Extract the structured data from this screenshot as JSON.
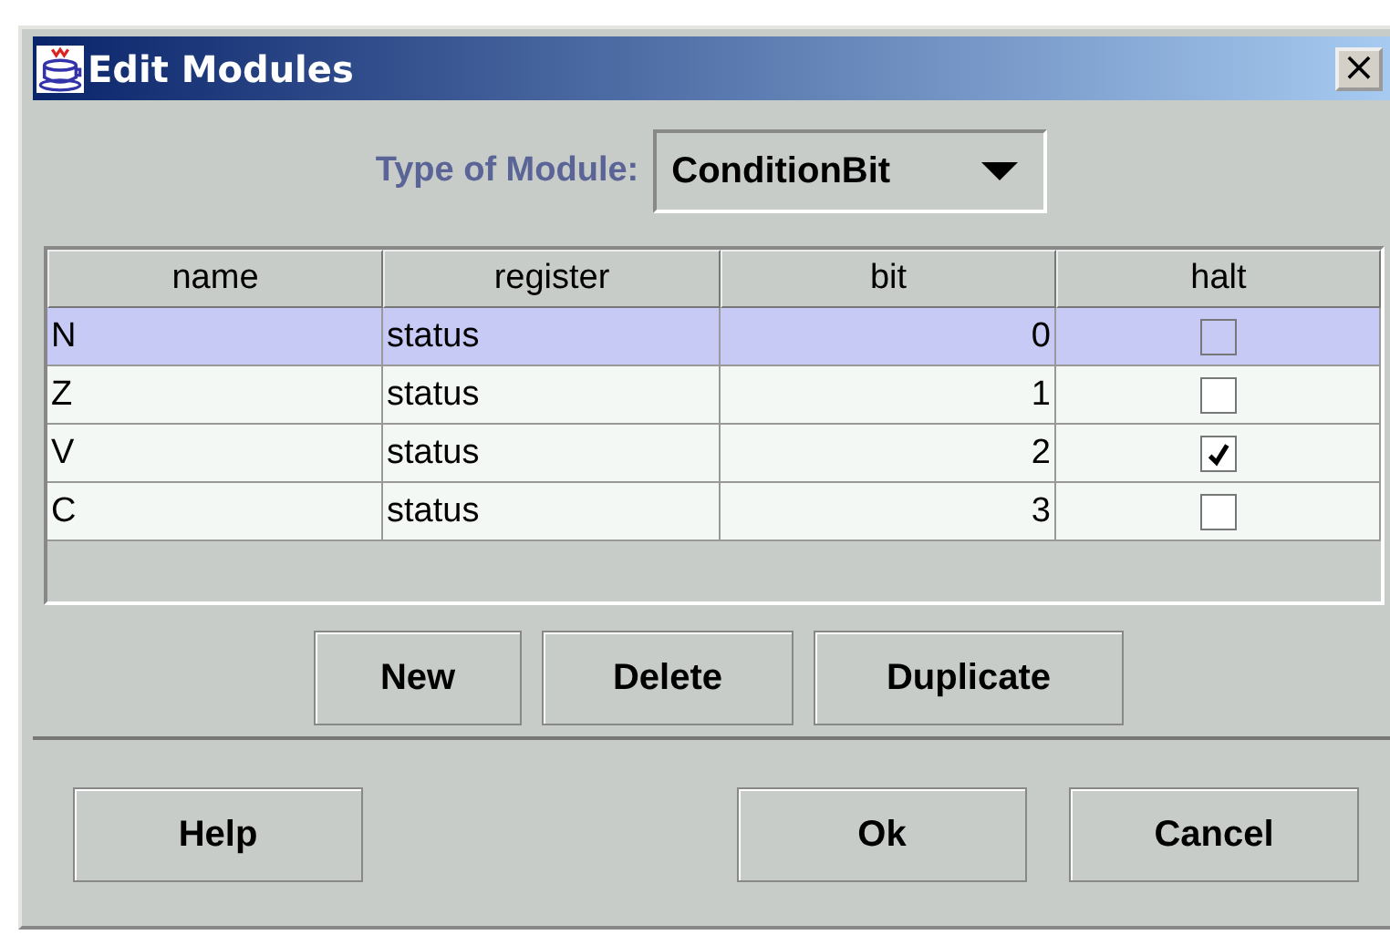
{
  "window": {
    "title": "Edit Modules",
    "close": "×"
  },
  "type_selector": {
    "label": "Type of Module:",
    "value": "ConditionBit"
  },
  "table": {
    "columns": [
      "name",
      "register",
      "bit",
      "halt"
    ],
    "rows": [
      {
        "name": "N",
        "register": "status",
        "bit": "0",
        "halt": false,
        "selected": true
      },
      {
        "name": "Z",
        "register": "status",
        "bit": "1",
        "halt": false,
        "selected": false
      },
      {
        "name": "V",
        "register": "status",
        "bit": "2",
        "halt": true,
        "selected": false
      },
      {
        "name": "C",
        "register": "status",
        "bit": "3",
        "halt": false,
        "selected": false
      }
    ]
  },
  "table_buttons": [
    "New",
    "Delete",
    "Duplicate"
  ],
  "dialog_buttons": [
    {
      "label": "Help",
      "kind": "left"
    },
    {
      "label": "Ok",
      "kind": "right"
    },
    {
      "label": "Cancel",
      "kind": "right"
    }
  ]
}
